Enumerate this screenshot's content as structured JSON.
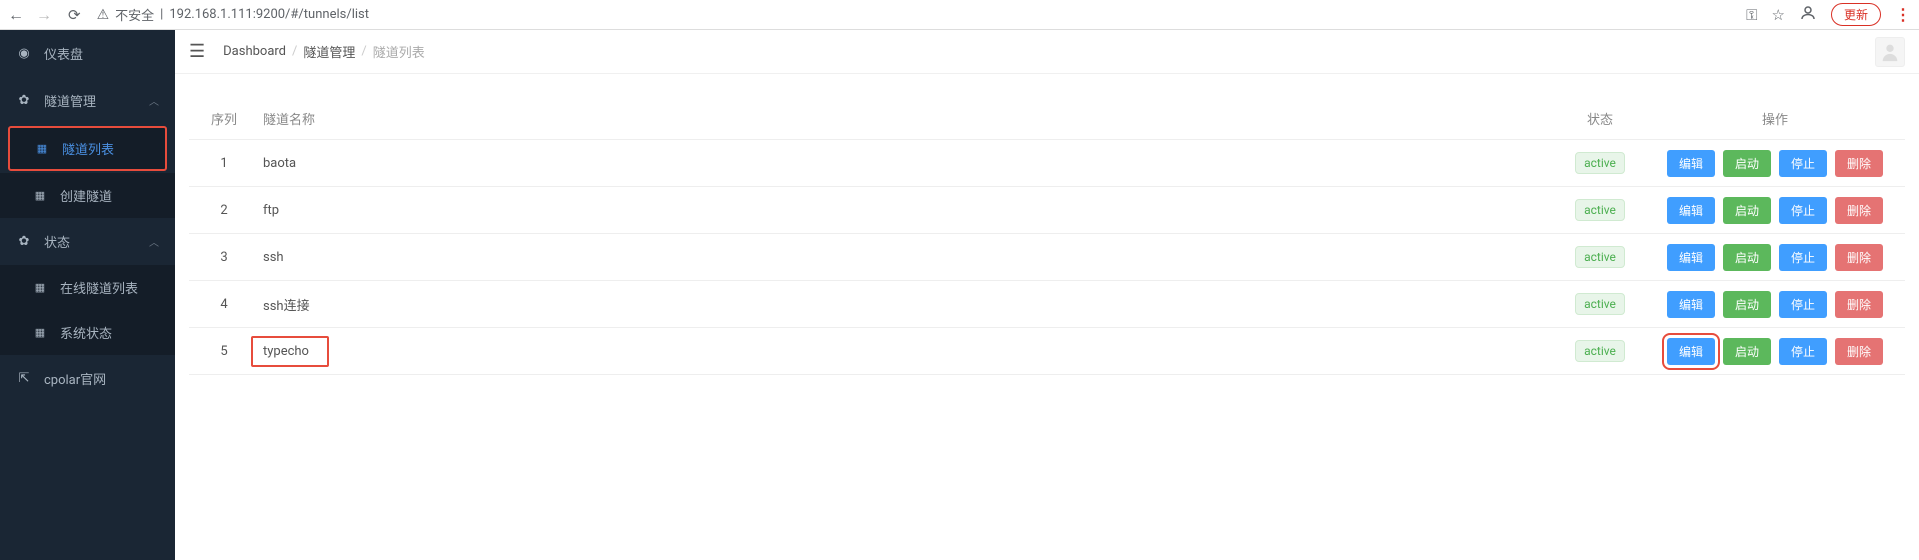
{
  "browser": {
    "insecure_label": "不安全",
    "url": "192.168.1.111:9200/#/tunnels/list",
    "update_label": "更新"
  },
  "sidebar": {
    "dashboard": "仪表盘",
    "tunnel_mgmt": "隧道管理",
    "tunnel_list": "隧道列表",
    "create_tunnel": "创建隧道",
    "status": "状态",
    "online_tunnels": "在线隧道列表",
    "system_status": "系统状态",
    "cpolar_site": "cpolar官网"
  },
  "breadcrumb": {
    "dashboard": "Dashboard",
    "tunnel_mgmt": "隧道管理",
    "tunnel_list": "隧道列表"
  },
  "table": {
    "headers": {
      "index": "序列",
      "name": "隧道名称",
      "status": "状态",
      "actions": "操作"
    },
    "status_active": "active",
    "actions": {
      "edit": "编辑",
      "start": "启动",
      "stop": "停止",
      "delete": "删除"
    },
    "rows": [
      {
        "idx": "1",
        "name": "baota"
      },
      {
        "idx": "2",
        "name": "ftp"
      },
      {
        "idx": "3",
        "name": "ssh"
      },
      {
        "idx": "4",
        "name": "ssh连接"
      },
      {
        "idx": "5",
        "name": "typecho"
      }
    ]
  }
}
